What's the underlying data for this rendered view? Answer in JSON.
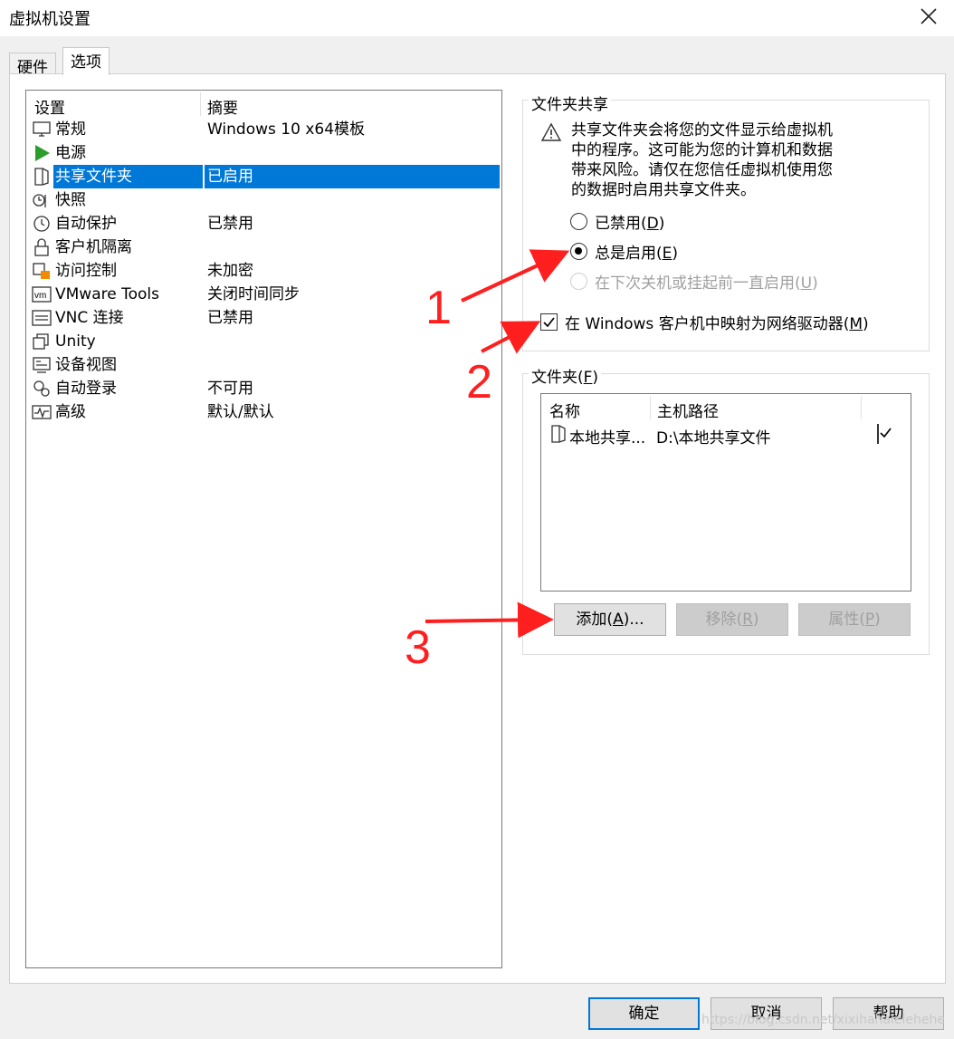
{
  "window": {
    "title": "虚拟机设置"
  },
  "tabs": [
    {
      "label": "硬件"
    },
    {
      "label": "选项"
    }
  ],
  "settings_list": {
    "headers": {
      "setting": "设置",
      "summary": "摘要"
    },
    "rows": [
      {
        "name": "常规",
        "summary": "Windows 10 x64模板",
        "icon": "monitor-icon"
      },
      {
        "name": "电源",
        "summary": "",
        "icon": "play-icon"
      },
      {
        "name": "共享文件夹",
        "summary": "已启用",
        "icon": "shared-folder-icon",
        "selected": true
      },
      {
        "name": "快照",
        "summary": "",
        "icon": "snapshot-icon"
      },
      {
        "name": "自动保护",
        "summary": "已禁用",
        "icon": "clock-icon"
      },
      {
        "name": "客户机隔离",
        "summary": "",
        "icon": "lock-icon"
      },
      {
        "name": "访问控制",
        "summary": "未加密",
        "icon": "access-control-icon"
      },
      {
        "name": "VMware Tools",
        "summary": "关闭时间同步",
        "icon": "vm-icon"
      },
      {
        "name": "VNC 连接",
        "summary": "已禁用",
        "icon": "vnc-icon"
      },
      {
        "name": "Unity",
        "summary": "",
        "icon": "unity-icon"
      },
      {
        "name": "设备视图",
        "summary": "",
        "icon": "device-view-icon"
      },
      {
        "name": "自动登录",
        "summary": "不可用",
        "icon": "auto-login-icon"
      },
      {
        "name": "高级",
        "summary": "默认/默认",
        "icon": "advanced-icon"
      }
    ]
  },
  "folder_sharing": {
    "title": "文件夹共享",
    "warning": "共享文件夹会将您的文件显示给虚拟机中的程序。这可能为您的计算机和数据带来风险。请仅在您信任虚拟机使用您的数据时启用共享文件夹。",
    "warning_lines": [
      "共享文件夹会将您的文件显示给虚拟机",
      "中的程序。这可能为您的计算机和数据",
      "带来风险。请仅在您信任虚拟机使用您",
      "的数据时启用共享文件夹。"
    ],
    "options": [
      {
        "label": "已禁用",
        "key": "D",
        "checked": false,
        "enabled": true
      },
      {
        "label": "总是启用",
        "key": "E",
        "checked": true,
        "enabled": true
      },
      {
        "label": "在下次关机或挂起前一直启用",
        "key": "U",
        "checked": false,
        "enabled": false
      }
    ],
    "map_drive": {
      "label": "在 Windows 客户机中映射为网络驱动器",
      "key": "M",
      "checked": true
    }
  },
  "folders": {
    "title": "文件夹",
    "title_key": "F",
    "headers": {
      "name": "名称",
      "host_path": "主机路径"
    },
    "rows": [
      {
        "name": "本地共享...",
        "host_path": "D:\\本地共享文件",
        "enabled": true
      }
    ],
    "buttons": [
      {
        "label": "添加",
        "key": "A",
        "suffix": "...",
        "enabled": true
      },
      {
        "label": "移除",
        "key": "R",
        "suffix": "",
        "enabled": false
      },
      {
        "label": "属性",
        "key": "P",
        "suffix": "",
        "enabled": false
      }
    ]
  },
  "footer": {
    "ok": "确定",
    "cancel": "取消",
    "help": "帮助"
  },
  "annotations": [
    "1",
    "2",
    "3"
  ],
  "annotation_color": "#ff1f1f",
  "watermark": "https://blog.csdn.net/xixihahalelehehe",
  "colors": {
    "selection": "#0078d7",
    "accent_arrow": "#ff1f1f"
  }
}
